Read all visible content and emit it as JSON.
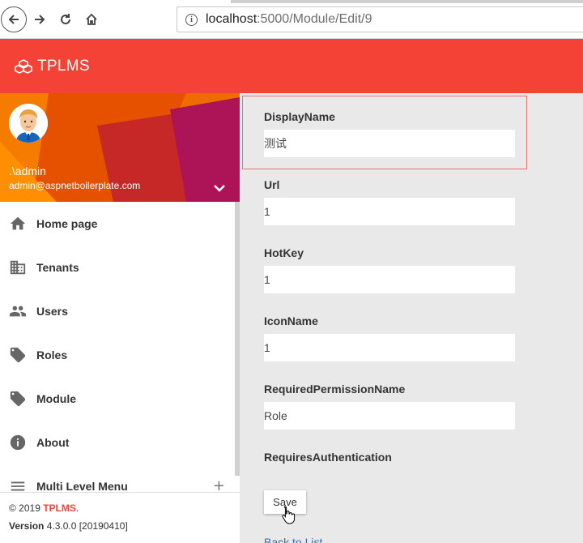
{
  "browser": {
    "url_host": "localhost",
    "url_path": ":5000/Module/Edit/9",
    "back_icon": "arrow-left-icon",
    "forward_icon": "arrow-right-icon",
    "reload_icon": "reload-icon",
    "home_icon": "home-icon",
    "info_icon": "info-icon"
  },
  "header": {
    "title": "TPLMS",
    "logo_icon": "cubes-icon",
    "color": "#f44336"
  },
  "user": {
    "name": ".\\admin",
    "email": "admin@aspnetboilerplate.com"
  },
  "menu": {
    "items": [
      {
        "label": "Home page",
        "icon": "home-icon"
      },
      {
        "label": "Tenants",
        "icon": "business-icon"
      },
      {
        "label": "Users",
        "icon": "people-icon"
      },
      {
        "label": "Roles",
        "icon": "tag-icon"
      },
      {
        "label": "Module",
        "icon": "tag-icon"
      },
      {
        "label": "About",
        "icon": "info-icon"
      },
      {
        "label": "Multi Level Menu",
        "icon": "menu-icon",
        "expand": "+"
      }
    ]
  },
  "footer": {
    "copyright_prefix": "© 2019 ",
    "brand": "TPLMS",
    "copyright_suffix": ".",
    "version_label": "Version",
    "version_value": " 4.3.0.0 [20190410]"
  },
  "form": {
    "fields": [
      {
        "label": "DisplayName",
        "value": "测试"
      },
      {
        "label": "Url",
        "value": "1"
      },
      {
        "label": "HotKey",
        "value": "1"
      },
      {
        "label": "IconName",
        "value": "1"
      },
      {
        "label": "RequiredPermissionName",
        "value": "Role"
      },
      {
        "label": "RequiresAuthentication"
      }
    ],
    "save_label": "Save",
    "back_label": "Back to List"
  }
}
